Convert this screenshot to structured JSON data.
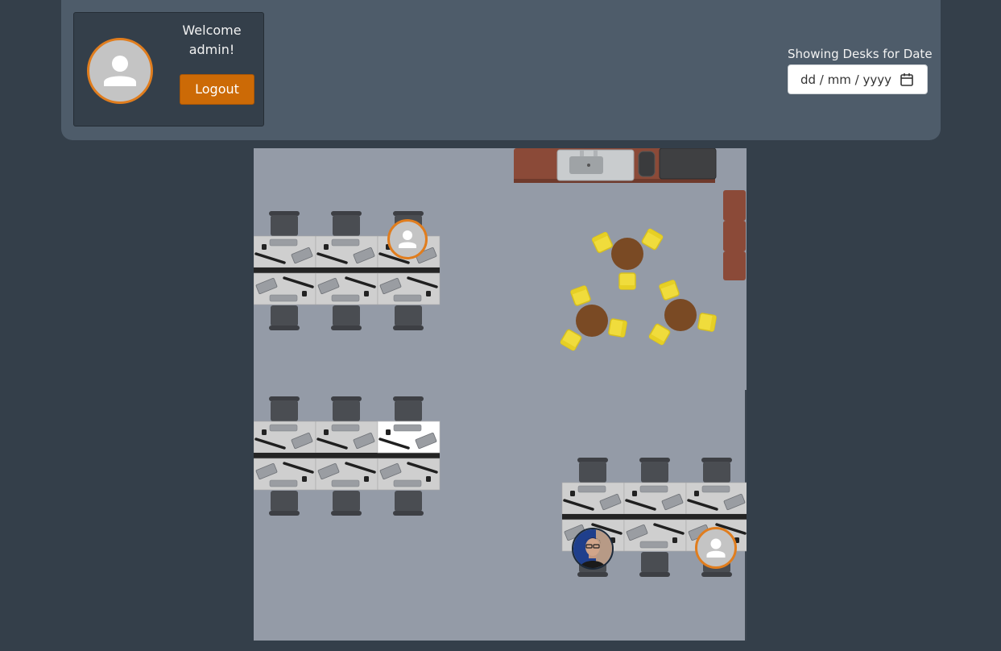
{
  "user": {
    "welcome_line1": "Welcome",
    "welcome_line2": "admin!",
    "avatar_icon": "person-icon",
    "logout_label": "Logout"
  },
  "date_filter": {
    "label": "Showing Desks for Date",
    "placeholder": "dd / mm / yyyy",
    "icon": "calendar-icon"
  },
  "colors": {
    "page_bg": "#343f4a",
    "header_bg": "#4e5c6a",
    "accent_orange": "#e07d1e",
    "logout_bg": "#cc6a06",
    "floor": "#949ba7",
    "desk": "#cfcfcf",
    "desk_selected": "#ffffff",
    "chair": "#3d3f44",
    "table_wood": "#7a4a24",
    "lounge_chair": "#f0dc3c",
    "counter": "#8b4a38"
  },
  "floor_plan": {
    "desk_clusters": [
      {
        "id": "cluster-a",
        "desks": 6,
        "booked": [
          {
            "row": 0,
            "col": 2,
            "avatar": "person-icon"
          }
        ]
      },
      {
        "id": "cluster-b",
        "desks": 6,
        "selected": [
          {
            "row": 0,
            "col": 2
          }
        ]
      },
      {
        "id": "cluster-c",
        "desks": 6,
        "booked": [
          {
            "row": 1,
            "col": 0,
            "avatar": "user-photo"
          },
          {
            "row": 1,
            "col": 2,
            "avatar": "person-icon"
          }
        ]
      }
    ],
    "kitchen": {
      "items": [
        "counter",
        "sink",
        "kettle",
        "appliance"
      ]
    },
    "lounge": {
      "round_tables": 3,
      "chairs_per_table": 3
    }
  }
}
